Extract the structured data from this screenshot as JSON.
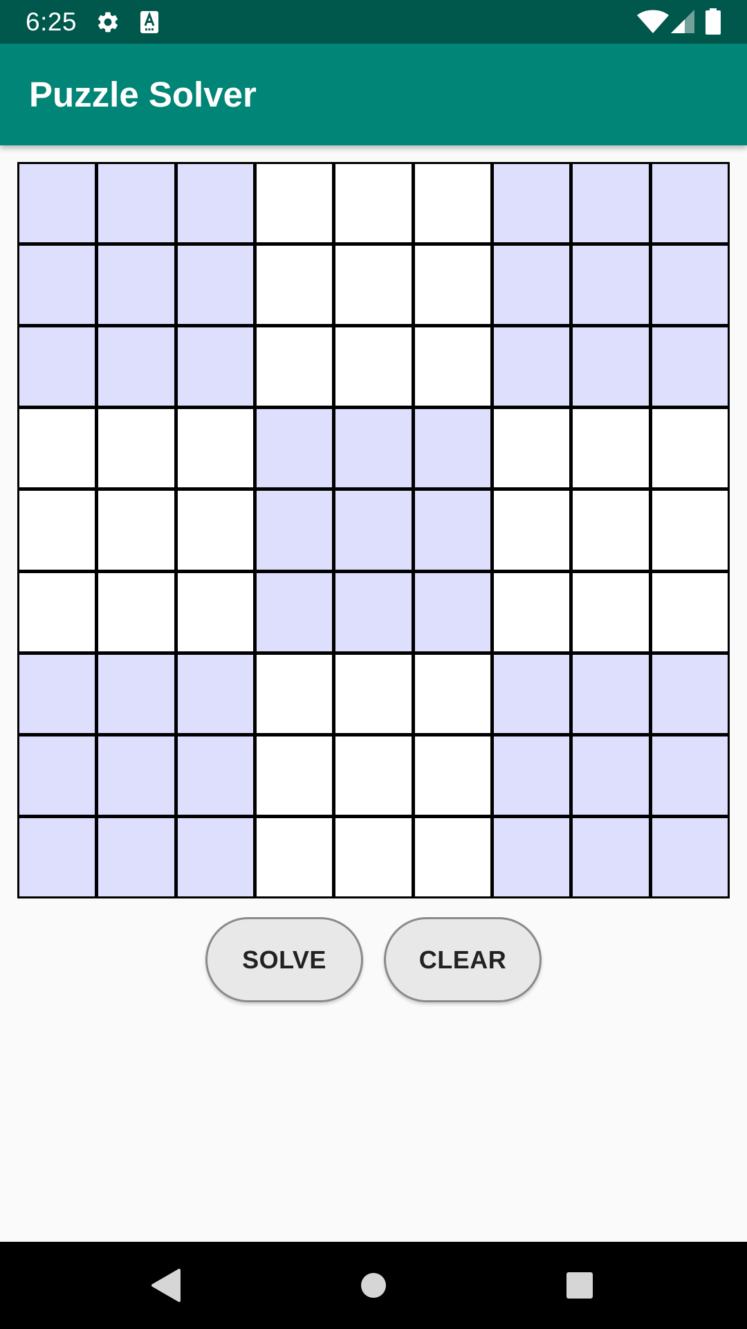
{
  "status_bar": {
    "time": "6:25",
    "left_icons": [
      "gear-icon",
      "keyboard-a-icon"
    ],
    "right_icons": [
      "wifi-icon",
      "cell-signal-icon",
      "battery-icon"
    ]
  },
  "app_bar": {
    "title": "Puzzle Solver",
    "color": "#008577"
  },
  "grid": {
    "rows": 9,
    "cols": 9,
    "values": [
      [
        "",
        "",
        "",
        "",
        "",
        "",
        "",
        "",
        ""
      ],
      [
        "",
        "",
        "",
        "",
        "",
        "",
        "",
        "",
        ""
      ],
      [
        "",
        "",
        "",
        "",
        "",
        "",
        "",
        "",
        ""
      ],
      [
        "",
        "",
        "",
        "",
        "",
        "",
        "",
        "",
        ""
      ],
      [
        "",
        "",
        "",
        "",
        "",
        "",
        "",
        "",
        ""
      ],
      [
        "",
        "",
        "",
        "",
        "",
        "",
        "",
        "",
        ""
      ],
      [
        "",
        "",
        "",
        "",
        "",
        "",
        "",
        "",
        ""
      ],
      [
        "",
        "",
        "",
        "",
        "",
        "",
        "",
        "",
        ""
      ],
      [
        "",
        "",
        "",
        "",
        "",
        "",
        "",
        "",
        ""
      ]
    ],
    "shaded_color": "#dedefd",
    "empty_color": "#ffffff",
    "line_color": "#000000"
  },
  "buttons": {
    "solve_label": "SOLVE",
    "clear_label": "CLEAR"
  },
  "nav_bar": {
    "icons": [
      "back-icon",
      "home-icon",
      "recents-icon"
    ]
  }
}
